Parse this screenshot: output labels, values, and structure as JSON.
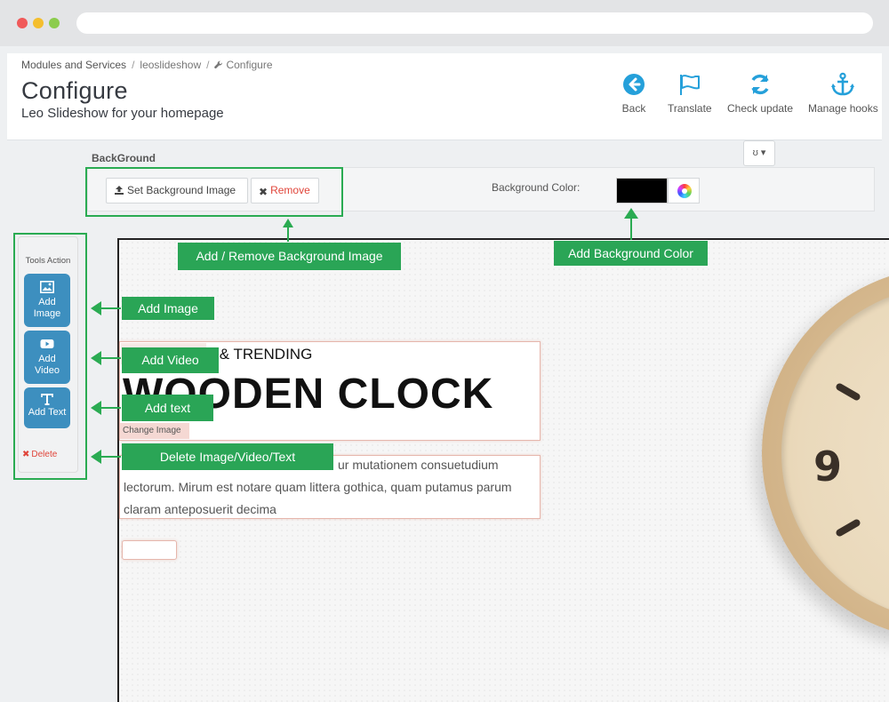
{
  "breadcrumb": {
    "item1": "Modules and Services",
    "item2": "leoslideshow",
    "item3": "Configure"
  },
  "header": {
    "title": "Configure",
    "subtitle": "Leo Slideshow for your homepage"
  },
  "toolbar": {
    "back": "Back",
    "translate": "Translate",
    "check_update": "Check update",
    "manage_hooks": "Manage hooks"
  },
  "background": {
    "heading": "BackGround",
    "language_toggle": "ʊ",
    "set_image_label": "Set Background Image",
    "remove_label": "Remove",
    "color_label": "Background Color:",
    "color_value": "#000000"
  },
  "tools": {
    "title": "Tools Action",
    "add_image": [
      "Add",
      "Image"
    ],
    "add_video": [
      "Add",
      "Video"
    ],
    "add_text": "Add Text",
    "delete": "Delete"
  },
  "slide": {
    "pretitle": "Y & TRENDING",
    "title": "WOODEN CLOCK",
    "change_image": "Change Image",
    "desc_line1": "ur mutationem consuetudium",
    "desc_line2": "lectorum. Mirum est notare quam littera gothica, quam putamus parum",
    "desc_line3": "claram anteposuerit decima",
    "clock_number": "9"
  },
  "annotations": {
    "add_remove_bg": "Add / Remove Background Image",
    "add_bg_color": "Add Background Color",
    "add_image": "Add Image",
    "add_video": "Add Video",
    "add_text": "Add text",
    "delete": "Delete Image/Video/Text"
  },
  "colors": {
    "accent_green": "#2aa556",
    "tool_blue": "#3d8fbf",
    "icon_blue": "#25a0da",
    "danger_red": "#e0453a"
  }
}
